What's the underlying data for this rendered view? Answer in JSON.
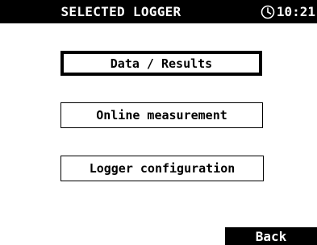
{
  "header": {
    "title": "SELECTED LOGGER",
    "time": "10:21",
    "clock_icon": "clock-icon"
  },
  "menu": {
    "items": [
      {
        "label": "Data / Results",
        "selected": true
      },
      {
        "label": "Online measurement",
        "selected": false
      },
      {
        "label": "Logger configuration",
        "selected": false
      }
    ]
  },
  "footer": {
    "back_label": "Back"
  },
  "colors": {
    "background": "#ffffff",
    "foreground": "#000000"
  }
}
